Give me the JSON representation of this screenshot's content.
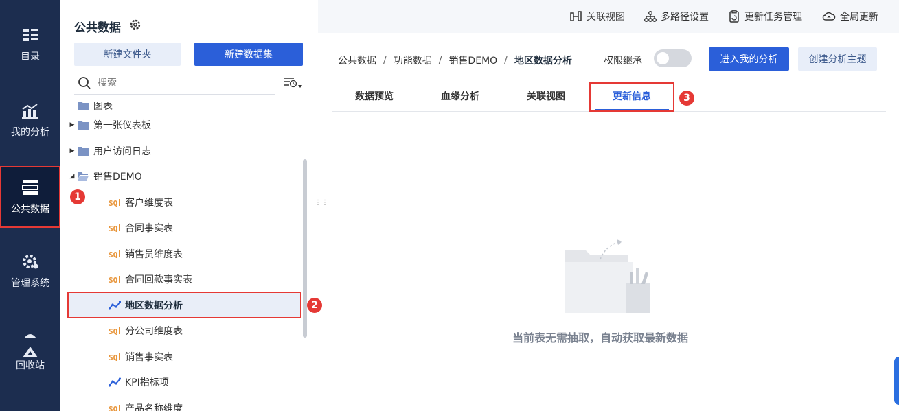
{
  "nav": {
    "items": [
      {
        "label": "目录",
        "icon": "catalog-icon"
      },
      {
        "label": "我的分析",
        "icon": "my-analysis-icon"
      },
      {
        "label": "公共数据",
        "icon": "public-data-icon",
        "active": true
      },
      {
        "label": "管理系统",
        "icon": "gear-icon"
      },
      {
        "label": "回收站",
        "icon": "recycle-icon"
      }
    ]
  },
  "tree": {
    "title": "公共数据",
    "new_folder_label": "新建文件夹",
    "new_dataset_label": "新建数据集",
    "search_placeholder": "搜索",
    "items": [
      {
        "label": "图表",
        "type": "folder"
      },
      {
        "label": "第一张仪表板",
        "type": "folder"
      },
      {
        "label": "用户访问日志",
        "type": "folder"
      },
      {
        "label": "销售DEMO",
        "type": "folder-open"
      },
      {
        "label": "客户维度表",
        "type": "sql"
      },
      {
        "label": "合同事实表",
        "type": "sql"
      },
      {
        "label": "销售员维度表",
        "type": "sql"
      },
      {
        "label": "合同回款事实表",
        "type": "sql"
      },
      {
        "label": "地区数据分析",
        "type": "analysis",
        "selected": true
      },
      {
        "label": "分公司维度表",
        "type": "sql"
      },
      {
        "label": "销售事实表",
        "type": "sql"
      },
      {
        "label": "KPI指标项",
        "type": "analysis"
      },
      {
        "label": "产品名称维度",
        "type": "sql"
      }
    ]
  },
  "topbar": {
    "actions": [
      "关联视图",
      "多路径设置",
      "更新任务管理",
      "全局更新"
    ]
  },
  "breadcrumb": {
    "items": [
      "公共数据",
      "功能数据",
      "销售DEMO",
      "地区数据分析"
    ],
    "sep": "/"
  },
  "permission_label": "权限继承",
  "enter_analysis_label": "进入我的分析",
  "create_subject_label": "创建分析主题",
  "tabs": [
    "数据预览",
    "血缘分析",
    "关联视图",
    "更新信息"
  ],
  "empty_message": "当前表无需抽取，自动获取最新数据",
  "badges": [
    "1",
    "2",
    "3"
  ],
  "colors": {
    "nav_bg": "#1c2d4f",
    "primary": "#2b5fd9",
    "highlight": "#e53935"
  }
}
